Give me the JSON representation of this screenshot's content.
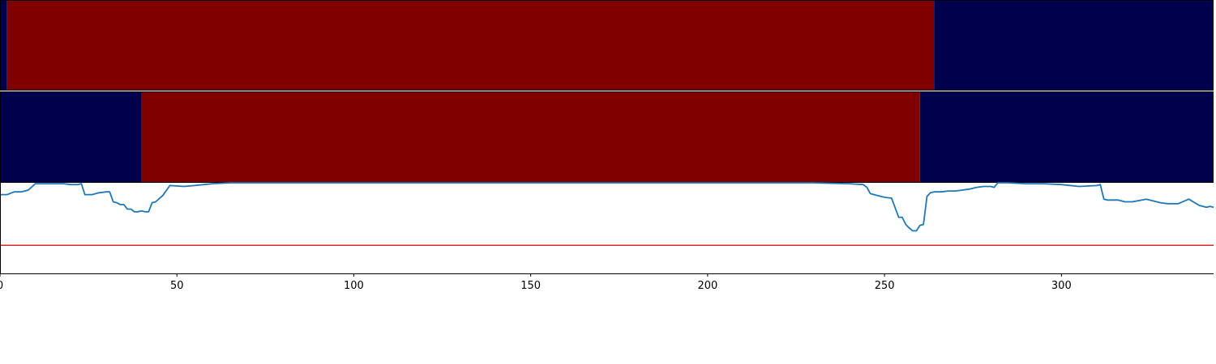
{
  "chart_data": [
    {
      "type": "heatmap",
      "description_role": "top-state-band",
      "x_range": [
        0,
        343
      ],
      "segments": [
        {
          "start": 0,
          "end": 2,
          "state": "low"
        },
        {
          "start": 2,
          "end": 264,
          "state": "high"
        },
        {
          "start": 264,
          "end": 343,
          "state": "low"
        }
      ]
    },
    {
      "type": "heatmap",
      "description_role": "middle-state-band",
      "x_range": [
        0,
        343
      ],
      "segments": [
        {
          "start": 0,
          "end": 40,
          "state": "low"
        },
        {
          "start": 40,
          "end": 260,
          "state": "high"
        },
        {
          "start": 260,
          "end": 343,
          "state": "low"
        }
      ]
    },
    {
      "type": "line",
      "xlim": [
        0,
        343
      ],
      "ylim": [
        0,
        1
      ],
      "xticks": [
        0,
        50,
        100,
        150,
        200,
        250,
        300
      ],
      "threshold": 0.31,
      "grid": false,
      "series": [
        {
          "x": [
            0,
            2,
            4,
            6,
            8,
            10,
            14,
            18,
            20,
            22,
            23,
            24,
            26,
            28,
            30,
            31,
            32,
            33,
            34,
            35,
            36,
            37,
            38,
            39,
            40,
            41,
            42,
            43,
            44,
            46,
            48,
            52,
            55,
            60,
            65,
            70,
            80,
            100,
            120,
            150,
            180,
            200,
            220,
            230,
            240,
            244,
            245,
            246,
            248,
            250,
            252,
            254,
            255,
            256,
            257,
            258,
            259,
            260,
            261,
            262,
            263,
            264,
            266,
            268,
            270,
            272,
            274,
            276,
            278,
            280,
            281,
            282,
            285,
            290,
            295,
            300,
            305,
            310,
            311,
            312,
            313,
            316,
            318,
            320,
            324,
            328,
            330,
            333,
            336,
            339,
            341,
            342,
            343
          ],
          "y": [
            0.87,
            0.87,
            0.9,
            0.9,
            0.92,
            0.99,
            0.99,
            0.99,
            0.98,
            0.98,
            0.99,
            0.87,
            0.87,
            0.89,
            0.9,
            0.9,
            0.79,
            0.78,
            0.76,
            0.76,
            0.71,
            0.71,
            0.68,
            0.68,
            0.69,
            0.68,
            0.68,
            0.78,
            0.79,
            0.86,
            0.97,
            0.96,
            0.97,
            0.99,
            1.0,
            1.0,
            1.0,
            1.0,
            1.0,
            1.0,
            1.0,
            1.0,
            1.0,
            1.0,
            0.99,
            0.98,
            0.95,
            0.88,
            0.86,
            0.84,
            0.83,
            0.62,
            0.62,
            0.54,
            0.5,
            0.47,
            0.47,
            0.53,
            0.54,
            0.85,
            0.89,
            0.9,
            0.9,
            0.91,
            0.91,
            0.92,
            0.93,
            0.95,
            0.96,
            0.96,
            0.95,
            1.0,
            1.0,
            0.99,
            0.99,
            0.98,
            0.96,
            0.97,
            0.98,
            0.82,
            0.81,
            0.81,
            0.79,
            0.79,
            0.82,
            0.78,
            0.77,
            0.77,
            0.82,
            0.75,
            0.73,
            0.74,
            0.73
          ]
        }
      ]
    }
  ],
  "colors": {
    "band_low": "#00004c",
    "band_high": "#800000",
    "line": "#1f77b4",
    "threshold": "#d62728",
    "axis": "#000000"
  }
}
